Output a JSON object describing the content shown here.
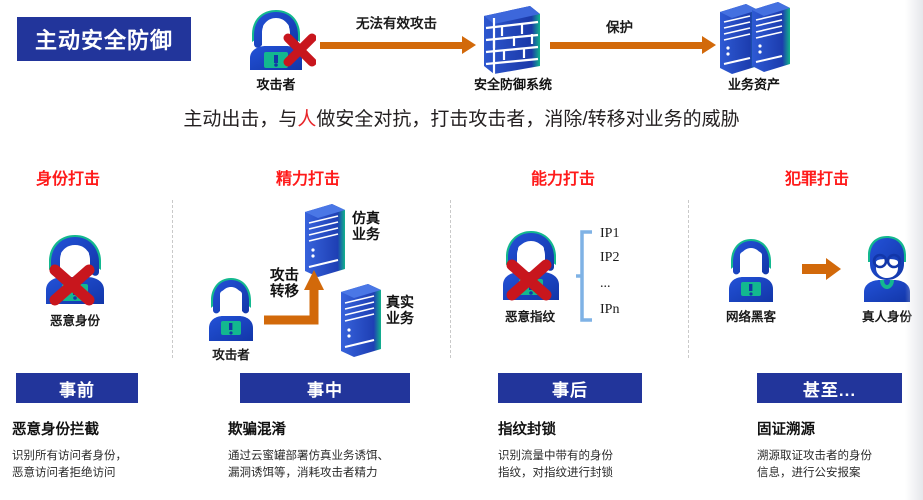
{
  "title_badge": {
    "label": "主动安全防御"
  },
  "top_flow": {
    "attacker": {
      "caption": "攻击者",
      "icon": "hacker-blocked-icon"
    },
    "arrow1_label": "无法有效攻击",
    "firewall": {
      "caption": "安全防御系统",
      "icon": "brick-firewall-icon"
    },
    "arrow2_label": "保护",
    "assets": {
      "caption": "业务资产",
      "icon": "server-stack-icon"
    }
  },
  "tagline": {
    "part1": "主动出击，与",
    "highlight": "人",
    "part2": "做安全对抗，打击攻击者，消除/转移对业务的威胁"
  },
  "columns": [
    {
      "heading": "身份打击",
      "banner": "事前",
      "block_title": "恶意身份拦截",
      "block_body": "识别所有访问者身份，\n恶意访问者拒绝访问",
      "icon_caption": "恶意身份"
    },
    {
      "heading": "精力打击",
      "banner": "事中",
      "block_title": "欺骗混淆",
      "block_body": "通过云蜜罐部署仿真业务诱饵、\n漏洞诱饵等，消耗攻击者精力",
      "attacker_caption": "攻击者",
      "transfer_label_line1": "攻击",
      "transfer_label_line2": "转移",
      "fake_label_line1": "仿真",
      "fake_label_line2": "业务",
      "real_label_line1": "真实",
      "real_label_line2": "业务"
    },
    {
      "heading": "能力打击",
      "banner": "事后",
      "block_title": "指纹封锁",
      "block_body": "识别流量中带有的身份\n指纹，对指纹进行封锁",
      "icon_caption": "恶意指纹",
      "ip_list": [
        "IP1",
        "IP2",
        "...",
        "IPn"
      ]
    },
    {
      "heading": "犯罪打击",
      "banner": "甚至...",
      "block_title": "固证溯源",
      "block_body": "溯源取证攻击者的身份\n信息，进行公安报案",
      "hacker_caption": "网络黑客",
      "person_caption": "真人身份"
    }
  ],
  "colors": {
    "brand_blue": "#22359B",
    "accent_orange": "#D2690A",
    "heading_red": "#FF1A1A",
    "icon_blue": "#1D4ED8",
    "icon_teal": "#14B8A6",
    "cross_red": "#C8161D",
    "divider_gray": "#C9C9C9"
  }
}
